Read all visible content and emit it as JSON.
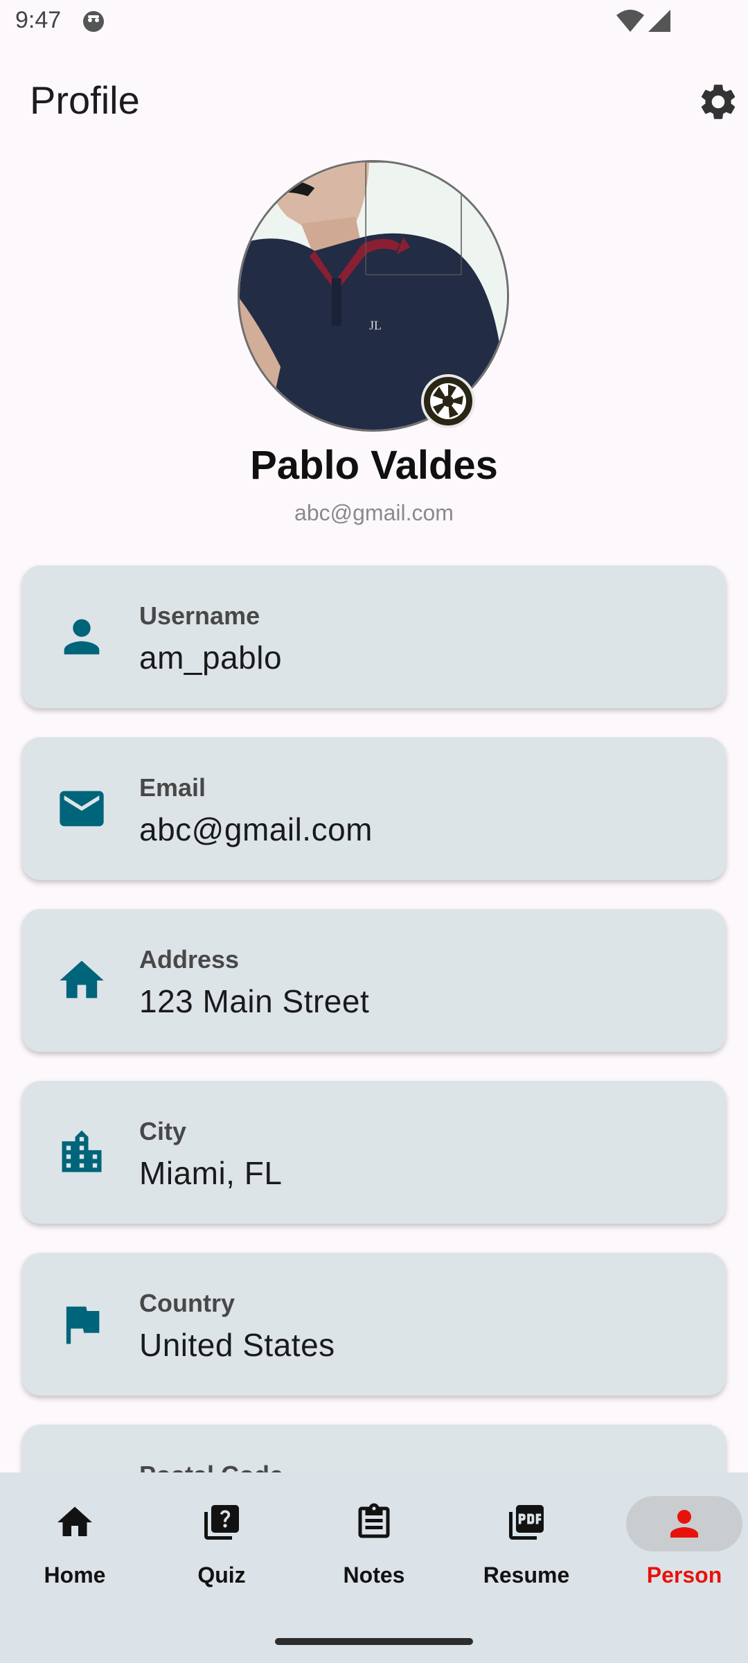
{
  "status_bar": {
    "time": "9:47"
  },
  "header": {
    "title": "Profile"
  },
  "profile": {
    "name": "Pablo Valdes",
    "email": "abc@gmail.com"
  },
  "fields": [
    {
      "label": "Username",
      "value": "am_pablo",
      "icon": "person-icon"
    },
    {
      "label": "Email",
      "value": "abc@gmail.com",
      "icon": "mail-icon"
    },
    {
      "label": "Address",
      "value": "123 Main Street",
      "icon": "home-icon"
    },
    {
      "label": "City",
      "value": "Miami, FL",
      "icon": "city-icon"
    },
    {
      "label": "Country",
      "value": "United States",
      "icon": "flag-icon"
    },
    {
      "label": "Postal Code",
      "value": "",
      "icon": "postal-icon"
    }
  ],
  "bottom_nav": [
    {
      "label": "Home",
      "icon": "home-icon"
    },
    {
      "label": "Quiz",
      "icon": "quiz-icon"
    },
    {
      "label": "Notes",
      "icon": "notes-icon"
    },
    {
      "label": "Resume",
      "icon": "pdf-icon"
    },
    {
      "label": "Person",
      "icon": "person-icon",
      "active": true
    }
  ],
  "colors": {
    "accent": "#00647a",
    "active_nav": "#e8120c",
    "card_bg": "#dde4e8",
    "background": "#fdf8fc"
  }
}
